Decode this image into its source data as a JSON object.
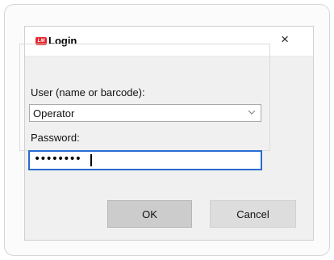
{
  "colors": {
    "logo_red": "#e3262d",
    "focus_blue": "#2a6bd1"
  },
  "dialog": {
    "logo_text": "LM",
    "title": "Login",
    "close_glyph": "×",
    "close_icon": "close-icon"
  },
  "user": {
    "label": "User (name or barcode):",
    "selected_value": "Operator",
    "dropdown_icon": "chevron-down-icon"
  },
  "password": {
    "label": "Password:",
    "value": "••••••••"
  },
  "buttons": {
    "ok": "OK",
    "cancel": "Cancel"
  }
}
